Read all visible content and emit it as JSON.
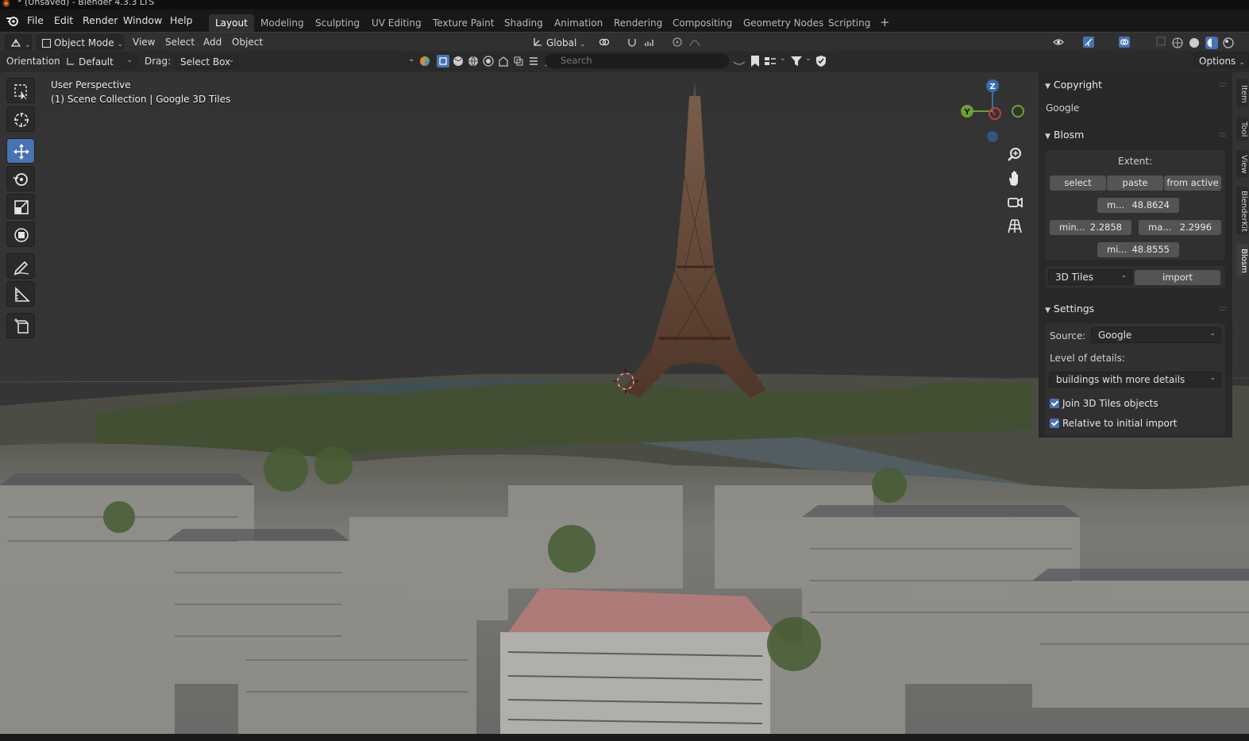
{
  "window": {
    "title": "* (Unsaved) - Blender 4.3.3 LTS"
  },
  "menu": [
    "File",
    "Edit",
    "Render",
    "Window",
    "Help"
  ],
  "workspaces": [
    {
      "label": "Layout",
      "active": true
    },
    {
      "label": "Modeling"
    },
    {
      "label": "Sculpting"
    },
    {
      "label": "UV Editing"
    },
    {
      "label": "Texture Paint"
    },
    {
      "label": "Shading"
    },
    {
      "label": "Animation"
    },
    {
      "label": "Rendering"
    },
    {
      "label": "Compositing"
    },
    {
      "label": "Geometry Nodes"
    },
    {
      "label": "Scripting"
    }
  ],
  "add_workspace_label": "+",
  "header": {
    "mode": "Object Mode",
    "menus": [
      "View",
      "Select",
      "Add",
      "Object"
    ],
    "transform_orientation": "Global"
  },
  "toolsettings": {
    "orientation_label": "Orientation:",
    "orientation_value": "Default",
    "drag_label": "Drag:",
    "drag_value": "Select Box",
    "search_placeholder": "Search",
    "options_label": "Options"
  },
  "viewport": {
    "line1": "User Perspective",
    "line2": "(1) Scene Collection | Google 3D Tiles",
    "axes": {
      "z": "Z",
      "y": "Y"
    }
  },
  "npanel": {
    "tabs": [
      "Item",
      "Tool",
      "View",
      "BlenderKit",
      "Blosm"
    ],
    "copyright": {
      "heading": "Copyright",
      "text": "Google"
    },
    "blosm": {
      "heading": "Blosm",
      "extent_label": "Extent:",
      "buttons": [
        "select",
        "paste",
        "from active"
      ],
      "max_lat": {
        "label": "m...",
        "value": "48.8624"
      },
      "min_lon": {
        "label": "min...",
        "value": "2.2858"
      },
      "max_lon": {
        "label": "ma...",
        "value": "2.2996"
      },
      "min_lat": {
        "label": "mi...",
        "value": "48.8555"
      },
      "data_type": "3D Tiles",
      "import_label": "import"
    },
    "settings": {
      "heading": "Settings",
      "source_label": "Source:",
      "source_value": "Google",
      "lod_label": "Level of details:",
      "lod_value": "buildings with more details",
      "join_label": "Join 3D Tiles objects",
      "join_checked": true,
      "relative_label": "Relative to initial import",
      "relative_checked": true
    }
  },
  "colors": {
    "accent": "#4772b3",
    "panel_bg": "#303030",
    "blender_orange": "#e87d0d"
  }
}
